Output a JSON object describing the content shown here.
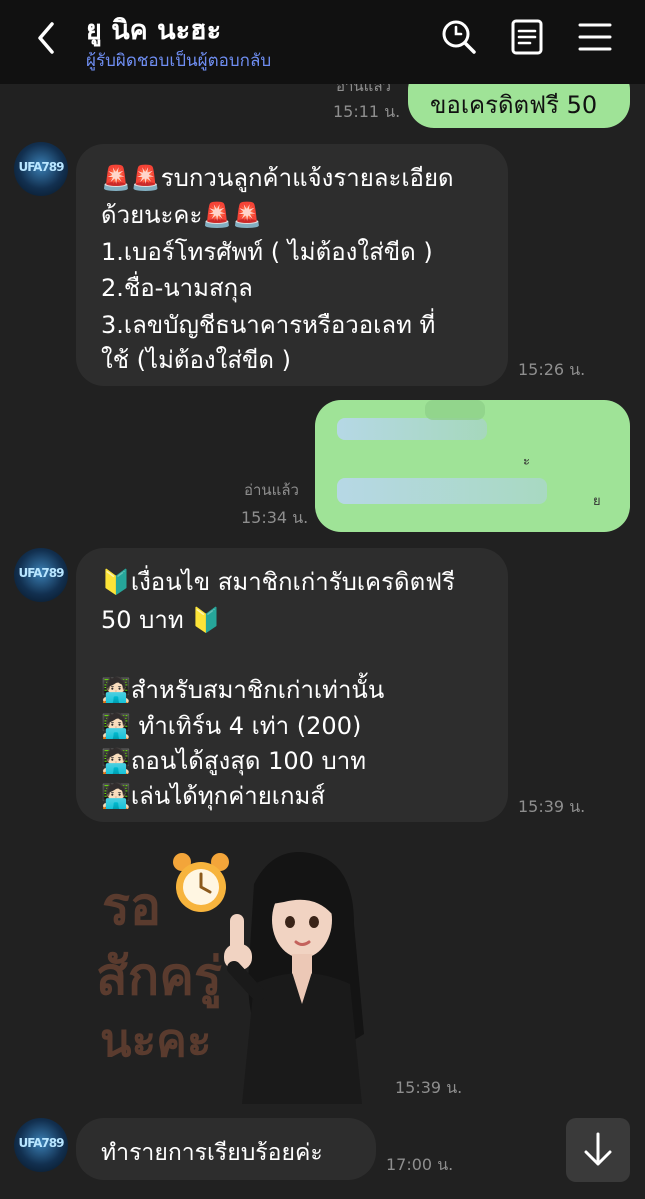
{
  "header": {
    "title": "ยู นิค นะฮะ",
    "subtitle": "ผู้รับผิดชอบเป็นผู้ตอบกลับ",
    "icons": [
      "back-icon",
      "search-icon",
      "notes-icon",
      "menu-icon"
    ]
  },
  "messages": {
    "m1": {
      "text": "ขอเครดิตฟรี 50",
      "read": "อ่านแล้ว",
      "time": "15:11 น."
    },
    "m2": {
      "lines": [
        "🚨🚨รบกวนลูกค้าแจ้งรายละเอียด",
        "ด้วยนะคะ🚨🚨",
        "1.เบอร์โทรศัพท์ ( ไม่ต้องใส่ขีด )",
        "2.ชื่อ-นามสกุล",
        "3.เลขบัญชีธนาคารหรือวอเลท ที่",
        "ใช้  (ไม่ต้องใส่ขีด )"
      ],
      "time": "15:26 น."
    },
    "m3": {
      "read": "อ่านแล้ว",
      "time": "15:34 น.",
      "tail1": "ะ",
      "tail2": "ย"
    },
    "m4": {
      "lines": [
        "🔰เงื่อนไข สมาชิกเก่ารับเครดิตฟรี",
        "50 บาท 🔰",
        "",
        "🧑🏻‍💻สำหรับสมาชิกเก่าเท่านั้น",
        "🧑🏻‍💻 ทำเทิร์น 4 เท่า (200)",
        "🧑🏻‍💻ถอนได้สูงสุด 100 บาท",
        "🧑🏻‍💻เล่นได้ทุกค่ายเกมส์"
      ],
      "time": "15:39 น."
    },
    "m5": {
      "sticker_lines": [
        "รอ",
        "สักครู่",
        "นะคะ"
      ],
      "time": "15:39 น."
    },
    "m6": {
      "text": "ทำรายการเรียบร้อยค่ะ",
      "time": "17:00 น."
    }
  },
  "avatar_label": "UFA789",
  "colors": {
    "header_bg": "#111111",
    "chat_bg": "#212121",
    "outgoing_bubble": "#9fe397",
    "incoming_bubble": "#2d2d2d",
    "subtitle": "#6f8ef2"
  }
}
